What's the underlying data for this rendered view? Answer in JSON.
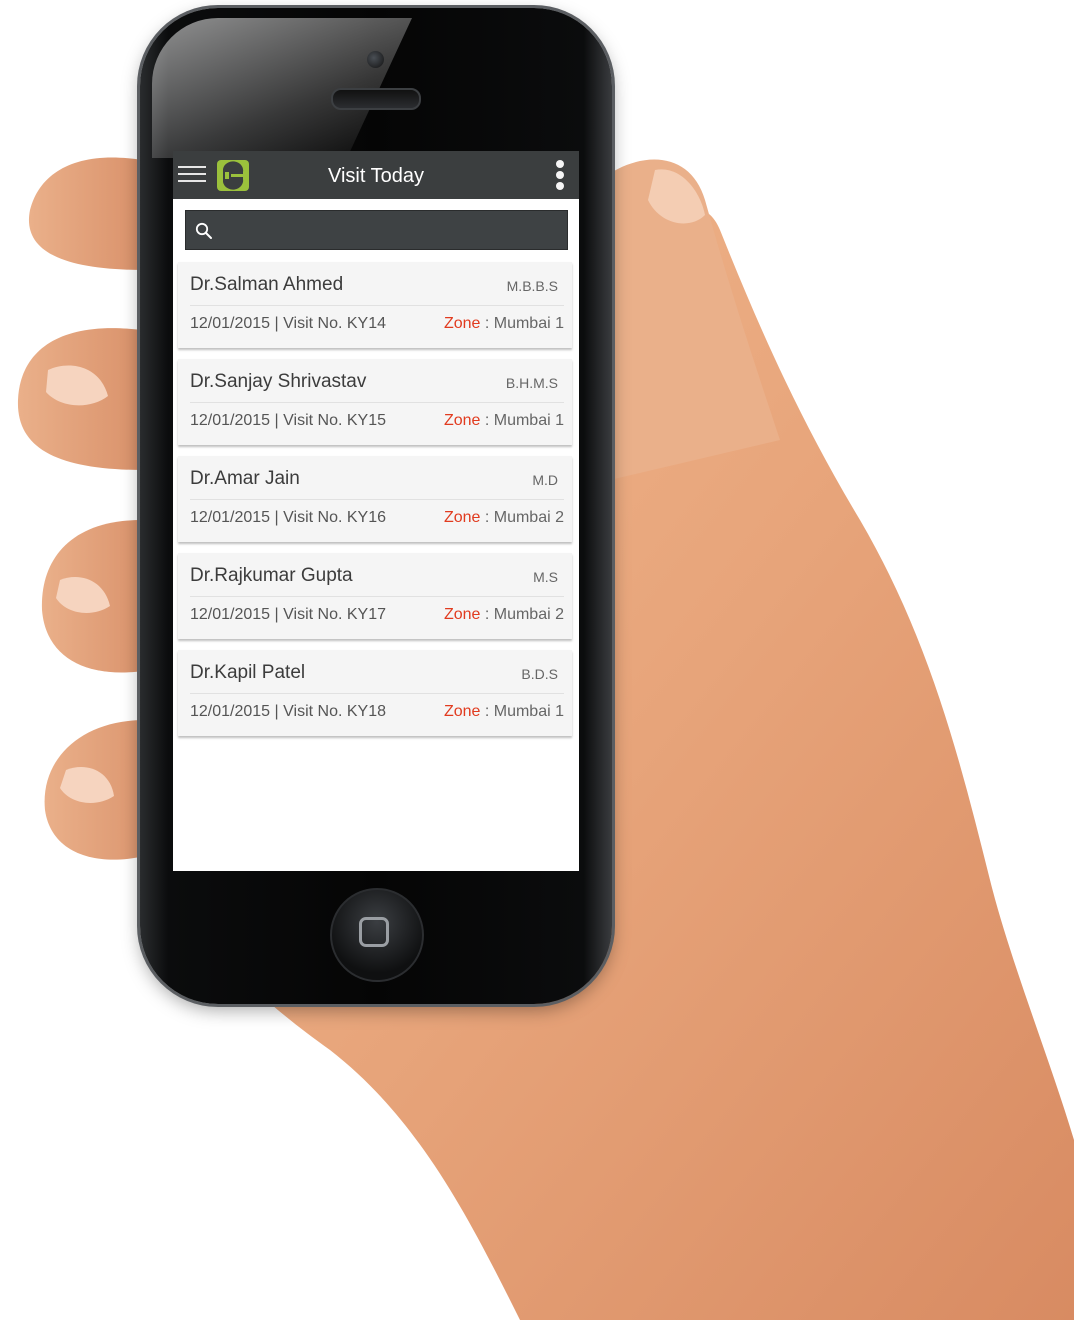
{
  "app_bar": {
    "title": "Visit Today",
    "menu_icon": "hamburger-menu-icon",
    "logo_icon": "app-logo-icon",
    "overflow_icon": "more-vert-icon"
  },
  "search": {
    "placeholder": "",
    "value": "",
    "icon": "search-icon"
  },
  "colors": {
    "app_bar": "#3b3e3f",
    "accent_logo": "#9bc13c",
    "zone_label": "#e13b1f",
    "card_bg": "#f5f5f5"
  },
  "visits": [
    {
      "name": "Dr.Salman Ahmed",
      "degree": "M.B.B.S",
      "date": "12/01/2015",
      "visit_no": "| Visit No. KY14",
      "zone_label": "Zone",
      "zone_value": " : Mumbai 1"
    },
    {
      "name": "Dr.Sanjay Shrivastav",
      "degree": "B.H.M.S",
      "date": "12/01/2015",
      "visit_no": "| Visit No. KY15",
      "zone_label": "Zone",
      "zone_value": " : Mumbai 1"
    },
    {
      "name": "Dr.Amar Jain",
      "degree": "M.D",
      "date": "12/01/2015",
      "visit_no": "| Visit No. KY16",
      "zone_label": "Zone",
      "zone_value": " : Mumbai 2"
    },
    {
      "name": "Dr.Rajkumar Gupta",
      "degree": "M.S",
      "date": "12/01/2015",
      "visit_no": "| Visit No. KY17",
      "zone_label": "Zone",
      "zone_value": " : Mumbai 2"
    },
    {
      "name": "Dr.Kapil Patel",
      "degree": "B.D.S",
      "date": "12/01/2015",
      "visit_no": "| Visit No. KY18",
      "zone_label": "Zone",
      "zone_value": " : Mumbai 1"
    }
  ]
}
